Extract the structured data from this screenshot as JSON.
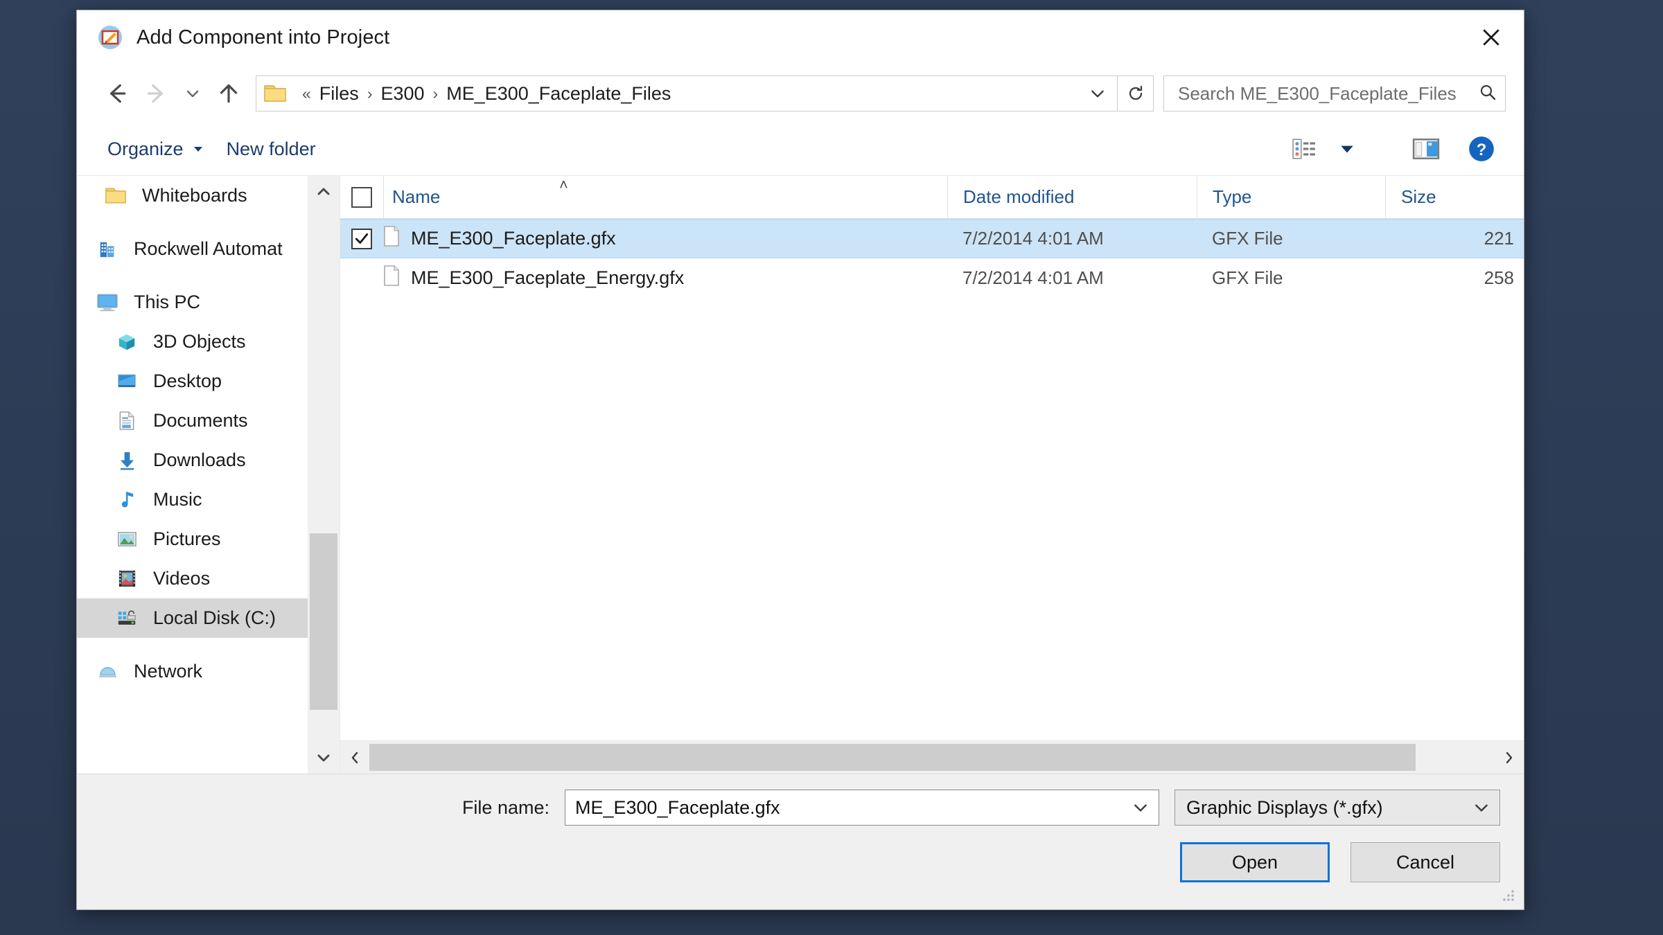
{
  "window": {
    "title": "Add Component into Project",
    "title_icon": "edit-image-icon",
    "close_label": "Close"
  },
  "nav": {
    "back": "Back",
    "forward": "Forward",
    "recent": "Recent locations",
    "up": "Up one level",
    "refresh": "Refresh",
    "breadcrumb": {
      "prefix": "«",
      "items": [
        "Files",
        "E300",
        "ME_E300_Faceplate_Files"
      ],
      "separator": "›"
    }
  },
  "search": {
    "placeholder": "Search ME_E300_Faceplate_Files",
    "value": "",
    "icon": "search-icon"
  },
  "toolbar": {
    "organize_label": "Organize",
    "new_folder_label": "New folder",
    "view_icon": "view-options-icon",
    "view_dropdown_icon": "chevron-down-icon",
    "preview_pane_icon": "preview-pane-icon",
    "help_icon": "help-icon"
  },
  "sidebar": {
    "items": [
      {
        "label": "Whiteboards",
        "icon": "folder-icon",
        "indent": "indent1",
        "selected": false
      },
      {
        "label": "Rockwell Automat",
        "icon": "building-icon",
        "indent": "",
        "selected": false
      },
      {
        "label": "This PC",
        "icon": "monitor-icon",
        "indent": "",
        "selected": false
      },
      {
        "label": "3D Objects",
        "icon": "cube-icon",
        "indent": "indent1",
        "selected": false
      },
      {
        "label": "Desktop",
        "icon": "desktop-icon",
        "indent": "indent1",
        "selected": false
      },
      {
        "label": "Documents",
        "icon": "documents-icon",
        "indent": "indent1",
        "selected": false
      },
      {
        "label": "Downloads",
        "icon": "downloads-icon",
        "indent": "indent1",
        "selected": false
      },
      {
        "label": "Music",
        "icon": "music-icon",
        "indent": "indent1",
        "selected": false
      },
      {
        "label": "Pictures",
        "icon": "pictures-icon",
        "indent": "indent1",
        "selected": false
      },
      {
        "label": "Videos",
        "icon": "videos-icon",
        "indent": "indent1",
        "selected": false
      },
      {
        "label": "Local Disk (C:)",
        "icon": "local-disk-icon",
        "indent": "indent1",
        "selected": true
      },
      {
        "label": "Network",
        "icon": "network-icon",
        "indent": "",
        "selected": false
      }
    ]
  },
  "filelist": {
    "columns": {
      "name": "Name",
      "date_modified": "Date modified",
      "type": "Type",
      "size": "Size"
    },
    "sort_indicator": "˄",
    "rows": [
      {
        "name": "ME_E300_Faceplate.gfx",
        "date_modified": "7/2/2014 4:01 AM",
        "type": "GFX File",
        "size": "221",
        "checked": true,
        "selected": true
      },
      {
        "name": "ME_E300_Faceplate_Energy.gfx",
        "date_modified": "7/2/2014 4:01 AM",
        "type": "GFX File",
        "size": "258",
        "checked": false,
        "selected": false
      }
    ]
  },
  "footer": {
    "filename_label": "File name:",
    "filename_value": "ME_E300_Faceplate.gfx",
    "filter_value": "Graphic Displays (*.gfx)",
    "open_label": "Open",
    "cancel_label": "Cancel"
  },
  "colors": {
    "accent": "#0a73d6",
    "selection": "#cce4f7",
    "backdrop": "#2c3b55",
    "link": "#20548f"
  }
}
